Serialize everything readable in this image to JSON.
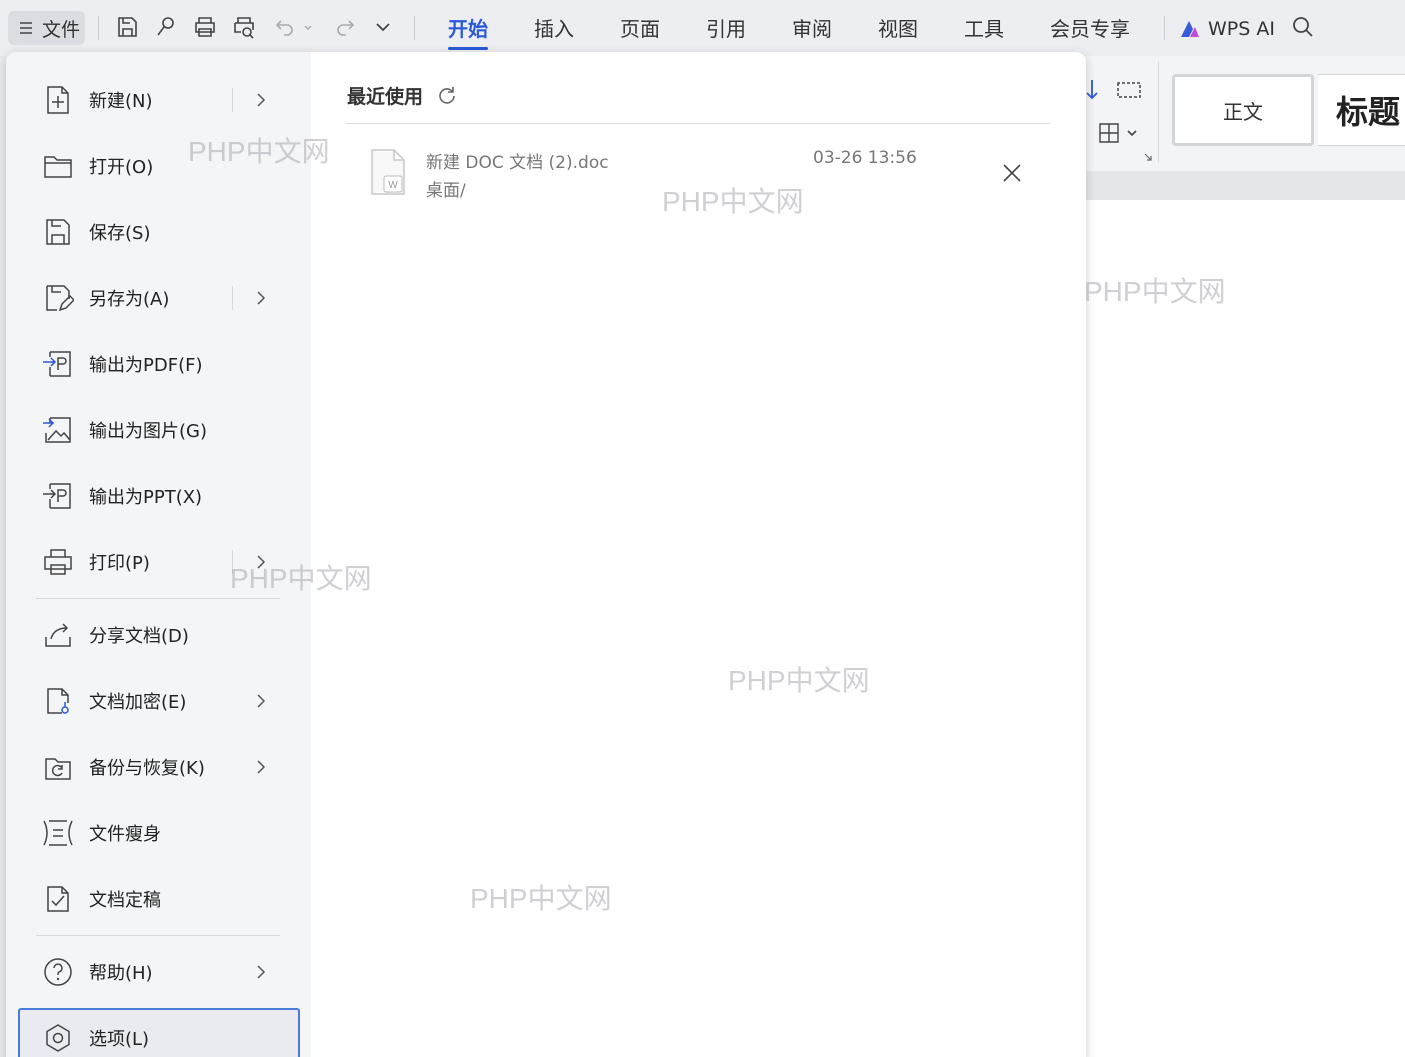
{
  "toolbar": {
    "file_label": "文件",
    "tabs": [
      "开始",
      "插入",
      "页面",
      "引用",
      "审阅",
      "视图",
      "工具",
      "会员专享"
    ],
    "active_tab": "开始",
    "wps_ai_label": "WPS AI"
  },
  "ribbon": {
    "style_normal": "正文",
    "style_heading": "标题"
  },
  "file_menu": {
    "items": [
      {
        "label": "新建(N)",
        "icon": "new-doc-icon",
        "submenu": true
      },
      {
        "label": "打开(O)",
        "icon": "folder-open-icon",
        "submenu": false
      },
      {
        "label": "保存(S)",
        "icon": "save-icon",
        "submenu": false
      },
      {
        "label": "另存为(A)",
        "icon": "save-as-icon",
        "submenu": true
      },
      {
        "label": "输出为PDF(F)",
        "icon": "export-pdf-icon",
        "submenu": false
      },
      {
        "label": "输出为图片(G)",
        "icon": "export-image-icon",
        "submenu": false
      },
      {
        "label": "输出为PPT(X)",
        "icon": "export-ppt-icon",
        "submenu": false
      },
      {
        "label": "打印(P)",
        "icon": "print-icon",
        "submenu": true
      },
      {
        "label": "分享文档(D)",
        "icon": "share-icon",
        "submenu": false
      },
      {
        "label": "文档加密(E)",
        "icon": "encrypt-doc-icon",
        "submenu": true
      },
      {
        "label": "备份与恢复(K)",
        "icon": "backup-restore-icon",
        "submenu": true
      },
      {
        "label": "文件瘦身",
        "icon": "file-slim-icon",
        "submenu": false
      },
      {
        "label": "文档定稿",
        "icon": "finalize-doc-icon",
        "submenu": false
      },
      {
        "label": "帮助(H)",
        "icon": "help-icon",
        "submenu": true
      },
      {
        "label": "选项(L)",
        "icon": "options-icon",
        "submenu": false,
        "selected": true
      }
    ]
  },
  "recent": {
    "title": "最近使用",
    "files": [
      {
        "name": "新建 DOC 文档 (2).doc",
        "path": "桌面/",
        "time": "03-26 13:56"
      }
    ]
  },
  "watermark": "PHP中文网",
  "colors": {
    "accent": "#2a5ad9",
    "selected_border": "#4b7bd8"
  }
}
